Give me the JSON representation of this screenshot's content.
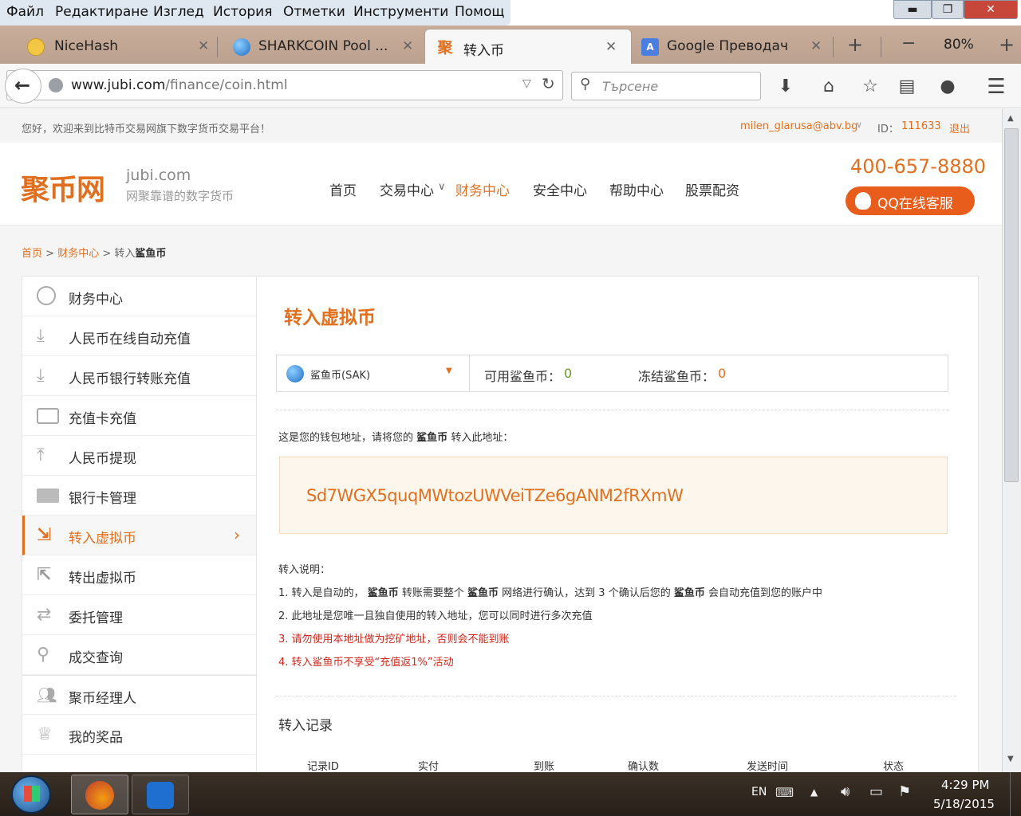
{
  "menu": [
    "Файл",
    "Редактиране",
    "Изглед",
    "История",
    "Отметки",
    "Инструменти",
    "Помощ"
  ],
  "window_controls": {
    "minimize": "▬",
    "maximize": "❐",
    "close": "✕"
  },
  "tabs": [
    {
      "label": "NiceHash",
      "icon": "smiley-icon",
      "color": "#f2c744"
    },
    {
      "label": "SHARKCOIN Pool ...",
      "icon": "sharkcoin-icon",
      "color": "#2a7fd4"
    },
    {
      "label": "转入币",
      "icon": "jubi-icon",
      "color": "#e0701f",
      "active": true
    },
    {
      "label": "Google Преводач",
      "icon": "google-translate-icon",
      "color": "#4a7fe0"
    }
  ],
  "tab_close": "✕",
  "tab_new": "+",
  "zoom": {
    "minus": "−",
    "value": "80%",
    "plus": "+"
  },
  "url": {
    "host": "www.jubi.com",
    "path": "/finance/coin.html"
  },
  "search_placeholder": "Търсене",
  "site": {
    "welcome": "您好，欢迎来到比特币交易网旗下数字货币交易平台！",
    "user_email": "milen_glarusa@abv.bg",
    "id_label": "ID：",
    "id_value": "111633",
    "logout": "退出",
    "logo_cn": "聚币网",
    "logo_domain": "jubi.com",
    "logo_slogan": "网聚靠谱的数字货币",
    "nav": [
      "首页",
      "交易中心",
      "财务中心",
      "安全中心",
      "帮助中心",
      "股票配资"
    ],
    "active_nav_index": 2,
    "phone": "400-657-8880",
    "qq_service": "QQ在线客服",
    "breadcrumb": {
      "home": "首页",
      "sep1": ">",
      "finance": "财务中心",
      "sep2": ">",
      "prefix": "转入",
      "current": "鲨鱼币"
    }
  },
  "sidebar": [
    {
      "label": "财务中心",
      "icon": "coins-icon"
    },
    {
      "label": "人民币在线自动充值",
      "icon": "download-tray-icon"
    },
    {
      "label": "人民币银行转账充值",
      "icon": "download-tray-icon"
    },
    {
      "label": "充值卡充值",
      "icon": "card-icon"
    },
    {
      "label": "人民币提现",
      "icon": "upload-tray-icon"
    },
    {
      "label": "银行卡管理",
      "icon": "bank-card-icon"
    },
    {
      "label": "转入虚拟币",
      "icon": "transfer-in-icon",
      "active": true
    },
    {
      "label": "转出虚拟币",
      "icon": "transfer-out-icon"
    },
    {
      "label": "委托管理",
      "icon": "swap-arrows-icon"
    },
    {
      "label": "成交查询",
      "icon": "magnifier-icon"
    },
    {
      "label": "聚币经理人",
      "icon": "people-icon"
    },
    {
      "label": "我的奖品",
      "icon": "trophy-icon"
    }
  ],
  "sidebar_chevron": "›",
  "main": {
    "title": "转入虚拟币",
    "coin_select": "鲨鱼币(SAK)",
    "available_label": "可用鲨鱼币：",
    "available_value": "0",
    "frozen_label": "冻结鲨鱼币：",
    "frozen_value": "0",
    "wallet_intro_a": "这是您的钱包地址，请将您的",
    "wallet_intro_coin": "鲨鱼币",
    "wallet_intro_b": "转入此地址：",
    "address": "Sd7WGX5quqMWtozUWVeiTZe6gANM2fRXmW",
    "notes_title": "转入说明：",
    "note1_a": "1. 转入是自动的，",
    "note1_coin1": "鲨鱼币",
    "note1_b": "转账需要整个",
    "note1_coin2": "鲨鱼币",
    "note1_c": "网络进行确认，达到 3 个确认后您的",
    "note1_coin3": "鲨鱼币",
    "note1_d": "会自动充值到您的账户中",
    "note2": "2. 此地址是您唯一且独自使用的转入地址，您可以同时进行多次充值",
    "note3": "3. 请勿使用本地址做为挖矿地址，否则会不能到账",
    "note4": "4. 转入鲨鱼币不享受“充值返1%”活动",
    "records_title": "转入记录",
    "records_columns": [
      "记录ID",
      "实付",
      "到账",
      "确认数",
      "发送时间",
      "状态"
    ]
  },
  "taskbar": {
    "lang": "EN",
    "time": "4:29 PM",
    "date": "5/18/2015"
  },
  "colors": {
    "accent": "#e0701f",
    "warning_red": "#d0261b",
    "address_bg": "#fdf6ec"
  }
}
